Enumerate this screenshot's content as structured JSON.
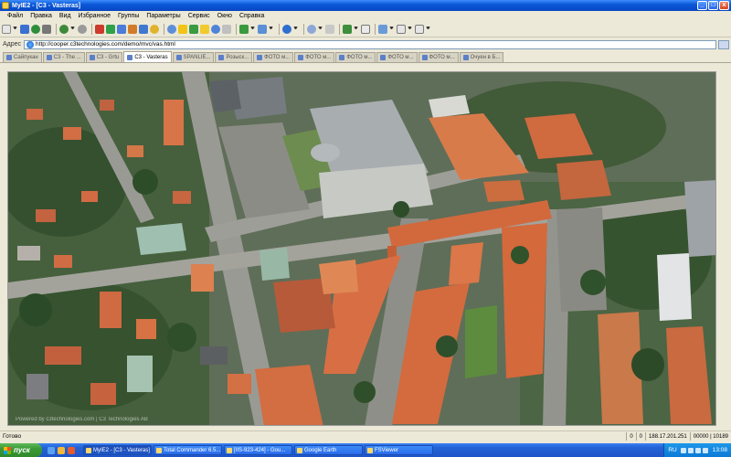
{
  "window": {
    "title": "MyIE2 - [C3 - Vasteras]",
    "min": "_",
    "max": "□",
    "close": "x"
  },
  "menu": [
    "Файл",
    "Правка",
    "Вид",
    "Избранное",
    "Группы",
    "Параметры",
    "Сервис",
    "Окно",
    "Справка"
  ],
  "address": {
    "label": "Адрес",
    "url": "http://cooper.c3technologies.com/demo/mvc/vas.html"
  },
  "tabs": [
    {
      "label": "Сайпукан",
      "active": false
    },
    {
      "label": "C3 - The ...",
      "active": false
    },
    {
      "label": "C3 - Grtu",
      "active": false
    },
    {
      "label": "C3 - Vasteras",
      "active": true
    },
    {
      "label": "SPANLIE...",
      "active": false
    },
    {
      "label": "Розыск...",
      "active": false
    },
    {
      "label": "ФОТО м...",
      "active": false
    },
    {
      "label": "ФОТО м...",
      "active": false
    },
    {
      "label": "ФОТО м...",
      "active": false
    },
    {
      "label": "ФОТО м...",
      "active": false
    },
    {
      "label": "ФОТО м...",
      "active": false
    },
    {
      "label": "Очуен в Б...",
      "active": false
    }
  ],
  "status": {
    "text": "Готово",
    "cells": [
      "0",
      "0",
      "188.17.201.251",
      "00000 | 10189"
    ]
  },
  "map": {
    "watermark": "Powered by c3technologies.com | C3 Technologies AB"
  },
  "taskbar": {
    "start": "пуск",
    "tasks": [
      {
        "label": "MyIE2 - [C3 - Vasteras]",
        "active": true
      },
      {
        "label": "Total Commander 6.5...",
        "active": false
      },
      {
        "label": "[IIS-923-424] - Gou...",
        "active": false
      },
      {
        "label": "Google Earth",
        "active": false
      },
      {
        "label": "FSViewer",
        "active": false
      }
    ],
    "lang": "RU",
    "clock": "13:08"
  },
  "colors": {
    "titlebar": "#0a58d8",
    "taskbar": "#245edb",
    "start": "#3a9a36",
    "roof": "#d1693d",
    "tree": "#2f5a2a",
    "road": "#9a9a94"
  }
}
